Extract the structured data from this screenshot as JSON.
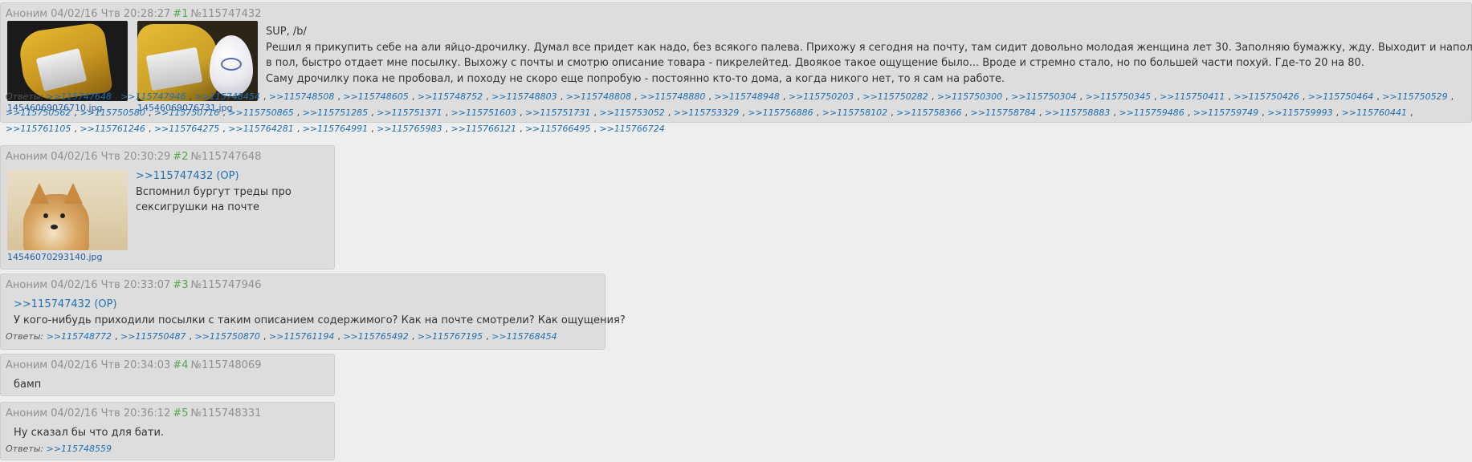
{
  "posts": [
    {
      "author": "Аноним",
      "date": "04/02/16 Чтв 20:28:27",
      "num": "#1",
      "id": "№115747432",
      "files": [
        "14546069076710.jpg",
        "14546069076731.jpg"
      ],
      "lines": [
        "SUP, /b/",
        "Решил я прикупить себе на али яйцо-дрочилку. Думал все придет как надо, без всякого палева. Прихожу я сегодня на почту, там сидит довольно молодая женщина лет 30. Заполняю бумажку, жду. Выходит и наполовину глядя",
        "в пол, быстро отдает мне посылку. Выхожу с почты и смотрю описание товара - пикрелейтед. Двоякое такое ощущение было... Вроде и стремно стало, но по большей части похуй. Где-то 20 на 80.",
        "Саму дрочилку пока не пробовал, и походу не скоро еще попробую - постоянно кто-то дома, а когда никого нет, то я сам на работе."
      ],
      "replies_label": "Ответы:",
      "replies": [
        ">>115747648",
        ">>115747946",
        ">>115748454",
        ">>115748508",
        ">>115748605",
        ">>115748752",
        ">>115748803",
        ">>115748808",
        ">>115748880",
        ">>115748948",
        ">>115750203",
        ">>115750282",
        ">>115750300",
        ">>115750304",
        ">>115750345",
        ">>115750411",
        ">>115750426",
        ">>115750464",
        ">>115750529",
        ">>115750562",
        ">>115750580",
        ">>115750716",
        ">>115750865",
        ">>115751285",
        ">>115751371",
        ">>115751603",
        ">>115751731",
        ">>115753052",
        ">>115753329",
        ">>115756886",
        ">>115758102",
        ">>115758366",
        ">>115758784",
        ">>115758883",
        ">>115759486",
        ">>115759749",
        ">>115759993",
        ">>115760441",
        ">>115761105",
        ">>115761246",
        ">>115764275",
        ">>115764281",
        ">>115764991",
        ">>115765983",
        ">>115766121",
        ">>115766495",
        ">>115766724"
      ]
    },
    {
      "author": "Аноним",
      "date": "04/02/16 Чтв 20:30:29",
      "num": "#2",
      "id": "№115747648",
      "files": [
        "14546070293140.jpg"
      ],
      "reply_to": ">>115747432 (OP)",
      "lines": [
        "Вспомнил бургут треды про",
        "сексигрушки на почте"
      ]
    },
    {
      "author": "Аноним",
      "date": "04/02/16 Чтв 20:33:07",
      "num": "#3",
      "id": "№115747946",
      "reply_to": ">>115747432 (OP)",
      "lines": [
        "У кого-нибудь приходили посылки с таким описанием содержимого? Как на почте смотрели? Как ощущения?"
      ],
      "replies_label": "Ответы:",
      "replies": [
        ">>115748772",
        ">>115750487",
        ">>115750870",
        ">>115761194",
        ">>115765492",
        ">>115767195",
        ">>115768454"
      ]
    },
    {
      "author": "Аноним",
      "date": "04/02/16 Чтв 20:34:03",
      "num": "#4",
      "id": "№115748069",
      "lines": [
        "бамп"
      ]
    },
    {
      "author": "Аноним",
      "date": "04/02/16 Чтв 20:36:12",
      "num": "#5",
      "id": "№115748331",
      "lines": [
        "Ну сказал бы что для бати."
      ],
      "replies_label": "Ответы:",
      "replies": [
        ">>115748559"
      ]
    }
  ]
}
